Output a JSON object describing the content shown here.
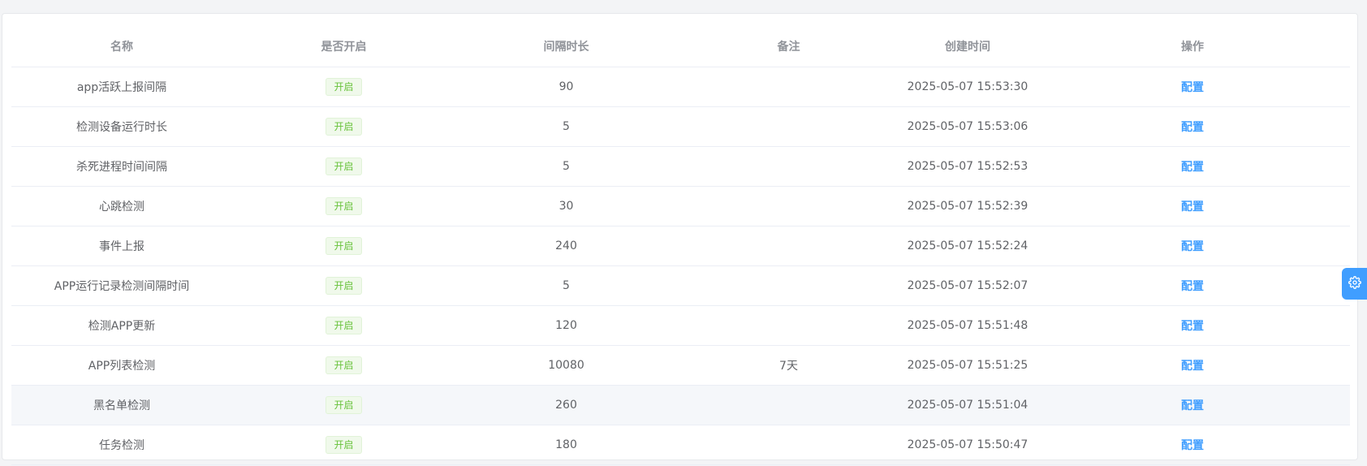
{
  "table": {
    "headers": {
      "name": "名称",
      "enabled": "是否开启",
      "interval": "间隔时长",
      "remark": "备注",
      "created": "创建时间",
      "action": "操作"
    },
    "rows": [
      {
        "name": "app活跃上报间隔",
        "status": "开启",
        "interval": "90",
        "remark": "",
        "created": "2025-05-07 15:53:30",
        "action": "配置"
      },
      {
        "name": "检测设备运行时长",
        "status": "开启",
        "interval": "5",
        "remark": "",
        "created": "2025-05-07 15:53:06",
        "action": "配置"
      },
      {
        "name": "杀死进程时间间隔",
        "status": "开启",
        "interval": "5",
        "remark": "",
        "created": "2025-05-07 15:52:53",
        "action": "配置"
      },
      {
        "name": "心跳检测",
        "status": "开启",
        "interval": "30",
        "remark": "",
        "created": "2025-05-07 15:52:39",
        "action": "配置"
      },
      {
        "name": "事件上报",
        "status": "开启",
        "interval": "240",
        "remark": "",
        "created": "2025-05-07 15:52:24",
        "action": "配置"
      },
      {
        "name": "APP运行记录检测间隔时间",
        "status": "开启",
        "interval": "5",
        "remark": "",
        "created": "2025-05-07 15:52:07",
        "action": "配置"
      },
      {
        "name": "检测APP更新",
        "status": "开启",
        "interval": "120",
        "remark": "",
        "created": "2025-05-07 15:51:48",
        "action": "配置"
      },
      {
        "name": "APP列表检测",
        "status": "开启",
        "interval": "10080",
        "remark": "7天",
        "created": "2025-05-07 15:51:25",
        "action": "配置"
      },
      {
        "name": "黑名单检测",
        "status": "开启",
        "interval": "260",
        "remark": "",
        "created": "2025-05-07 15:51:04",
        "action": "配置"
      },
      {
        "name": "任务检测",
        "status": "开启",
        "interval": "180",
        "remark": "",
        "created": "2025-05-07 15:50:47",
        "action": "配置"
      }
    ],
    "hovered_row": 8
  },
  "floating": {
    "icon": "gear-icon"
  },
  "colors": {
    "accent": "#409eff",
    "tag_text": "#67c23a",
    "tag_bg": "#f0f9eb",
    "tag_border": "#e1f3d8"
  }
}
